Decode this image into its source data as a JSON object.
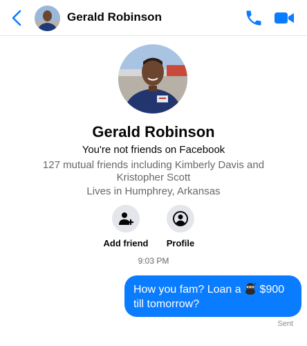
{
  "header": {
    "title": "Gerald Robinson",
    "icons": [
      "chevron-left-icon",
      "phone-icon",
      "video-camera-icon"
    ],
    "accent": "#0a7cff"
  },
  "profile": {
    "name": "Gerald Robinson",
    "friend_status": "You're not friends on Facebook",
    "mutual_friends": "127 mutual friends including Kimberly Davis and Kristopher Scott",
    "location": "Lives in Humphrey, Arkansas"
  },
  "actions": {
    "add_friend": "Add friend",
    "profile": "Profile"
  },
  "conversation": {
    "timestamp": "9:03 PM",
    "message_before": "How you fam? Loan a ",
    "message_emoji": "ninja-emoji",
    "message_after": " $900 till tomorrow?",
    "status": "Sent",
    "bubble_color": "#0a7cff"
  }
}
